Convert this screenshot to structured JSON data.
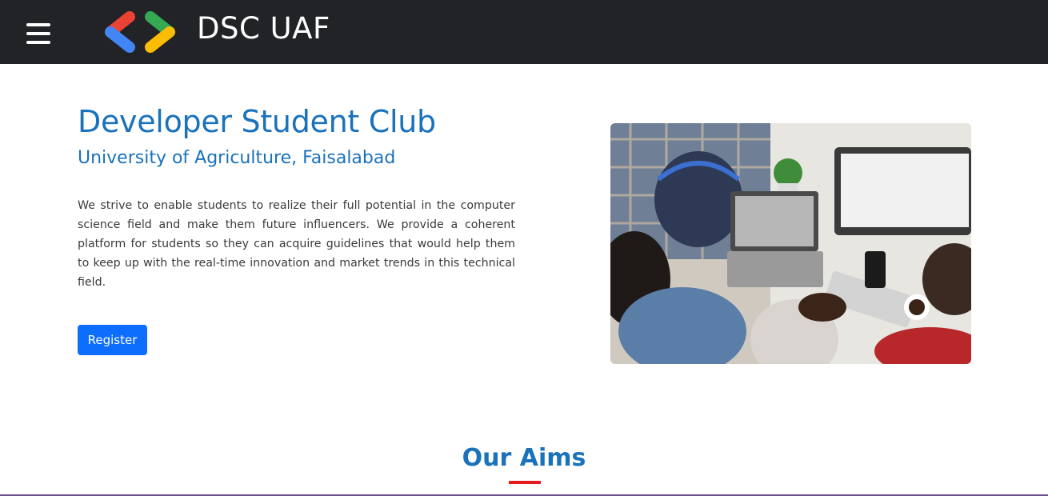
{
  "navbar": {
    "menu_icon": "hamburger-menu-icon",
    "logo_icon": "dsc-logo-icon",
    "brand": "DSC UAF",
    "background": "#222327"
  },
  "hero": {
    "title": "Developer Student Club",
    "subtitle": "University of Agriculture, Faisalabad",
    "description": "We strive to enable students to realize their full potential in the computer science field and make them future influencers. We provide a coherent platform for students so they can acquire guidelines that would help them to keep up with the real-time innovation and market trends in this technical field.",
    "register_label": "Register",
    "accent": "#1a72bb",
    "button_color": "#0d6efd"
  },
  "aims": {
    "title": "Our Aims",
    "underline_color": "#e11d1d"
  }
}
